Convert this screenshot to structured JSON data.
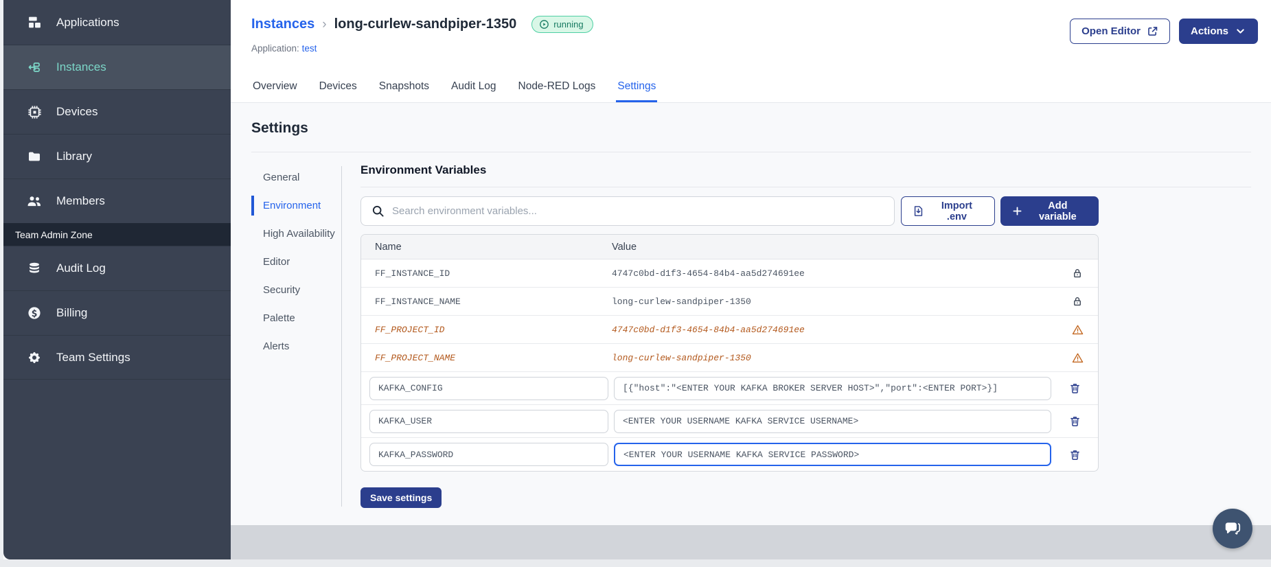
{
  "sidebar": {
    "items": [
      {
        "label": "Applications",
        "icon": "applications-icon",
        "active": false
      },
      {
        "label": "Instances",
        "icon": "instances-icon",
        "active": true
      },
      {
        "label": "Devices",
        "icon": "devices-icon",
        "active": false
      },
      {
        "label": "Library",
        "icon": "library-icon",
        "active": false
      },
      {
        "label": "Members",
        "icon": "members-icon",
        "active": false
      }
    ],
    "section_label": "Team Admin Zone",
    "admin_items": [
      {
        "label": "Audit Log",
        "icon": "audit-log-icon",
        "active": false
      },
      {
        "label": "Billing",
        "icon": "billing-icon",
        "active": false
      },
      {
        "label": "Team Settings",
        "icon": "team-settings-icon",
        "active": false
      }
    ]
  },
  "header": {
    "breadcrumb_parent": "Instances",
    "breadcrumb_separator": "›",
    "instance_name": "long-curlew-sandpiper-1350",
    "status_badge": "running",
    "application_label": "Application:",
    "application_name": "test",
    "open_editor_label": "Open Editor",
    "actions_label": "Actions"
  },
  "tabs": [
    {
      "label": "Overview",
      "active": false
    },
    {
      "label": "Devices",
      "active": false
    },
    {
      "label": "Snapshots",
      "active": false
    },
    {
      "label": "Audit Log",
      "active": false
    },
    {
      "label": "Node-RED Logs",
      "active": false
    },
    {
      "label": "Settings",
      "active": true
    }
  ],
  "settings": {
    "title": "Settings",
    "nav": [
      {
        "label": "General",
        "active": false
      },
      {
        "label": "Environment",
        "active": true
      },
      {
        "label": "High Availability",
        "active": false
      },
      {
        "label": "Editor",
        "active": false
      },
      {
        "label": "Security",
        "active": false
      },
      {
        "label": "Palette",
        "active": false
      },
      {
        "label": "Alerts",
        "active": false
      }
    ],
    "panel_title": "Environment Variables",
    "search_placeholder": "Search environment variables...",
    "import_label": "Import .env",
    "add_label": "Add variable",
    "save_label": "Save settings",
    "table": {
      "columns": [
        "Name",
        "Value"
      ],
      "rows": [
        {
          "name": "FF_INSTANCE_ID",
          "value": "4747c0bd-d1f3-4654-84b4-aa5d274691ee",
          "type": "locked",
          "icon": "lock-icon",
          "focused": false
        },
        {
          "name": "FF_INSTANCE_NAME",
          "value": "long-curlew-sandpiper-1350",
          "type": "locked",
          "icon": "lock-icon",
          "focused": false
        },
        {
          "name": "FF_PROJECT_ID",
          "value": "4747c0bd-d1f3-4654-84b4-aa5d274691ee",
          "type": "deprecated",
          "icon": "warning-icon",
          "focused": false
        },
        {
          "name": "FF_PROJECT_NAME",
          "value": "long-curlew-sandpiper-1350",
          "type": "deprecated",
          "icon": "warning-icon",
          "focused": false
        },
        {
          "name": "KAFKA_CONFIG",
          "value": "[{\"host\":\"<ENTER YOUR KAFKA BROKER SERVER HOST>\",\"port\":<ENTER PORT>}]",
          "type": "editable",
          "icon": "trash-icon",
          "focused": false
        },
        {
          "name": "KAFKA_USER",
          "value": "<ENTER YOUR USERNAME KAFKA SERVICE USERNAME>",
          "type": "editable",
          "icon": "trash-icon",
          "focused": false
        },
        {
          "name": "KAFKA_PASSWORD",
          "value": "<ENTER YOUR USERNAME KAFKA SERVICE PASSWORD>",
          "type": "editable",
          "icon": "trash-icon",
          "focused": true
        }
      ]
    }
  },
  "colors": {
    "sidebar_bg": "#3a4252",
    "accent_teal": "#7cd7c8",
    "primary_navy": "#2b3e8d",
    "link_blue": "#2563eb",
    "deprecated_orange": "#b3591d",
    "status_green_bg": "#d9f7e7",
    "status_green_border": "#4ecfa3",
    "status_green_text": "#177a61"
  }
}
